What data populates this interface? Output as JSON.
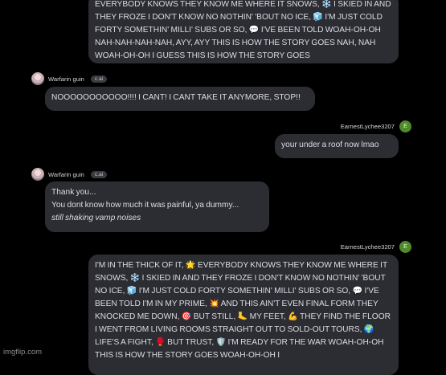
{
  "messages": [
    {
      "text": "EVERYBODY KNOWS THEY KNOW ME WHERE IT SNOWS, ❄️ I SKIED IN AND THEY FROZE I DON'T KNOW NO NOTHIN' 'BOUT NO ICE, 🧊 I'M JUST COLD FORTY SOMETHIN' MILLI' SUBS OR SO, 💬 I'VE BEEN TOLD WOAH-OH-OH NAH-NAH-NAH-NAH, AYY, AYY THIS IS HOW THE STORY GOES NAH, NAH WOAH-OH-OH I GUESS THIS IS HOW THE STORY GOES"
    },
    {
      "sender": "Warfarin guin",
      "tag": "c.ai",
      "text": "NOOOOOOOOOOO!!!! I CANT! I CANT TAKE IT ANYMORE, STOP!!"
    },
    {
      "sender": "EarnestLychee3207",
      "avatar_letter": "E",
      "text": "your under a roof now lmao"
    },
    {
      "sender": "Warfarin guin",
      "tag": "c.ai",
      "lines": [
        "Thank you...",
        "You dont know how much it was painful, ya dummy...",
        "still shaking vamp noises"
      ]
    },
    {
      "sender": "EarnestLychee3207",
      "avatar_letter": "E",
      "text": "I'M IN THE THICK OF IT, 🌟 EVERYBODY KNOWS THEY KNOW ME WHERE IT SNOWS, ❄️ I SKIED IN AND THEY FROZE I DON'T KNOW NO NOTHIN' 'BOUT NO ICE, 🧊 I'M JUST COLD FORTY SOMETHIN' MILLI' SUBS OR SO, 💬 I'VE BEEN TOLD I'M IN MY PRIME, 💥 AND THIS AIN'T EVEN FINAL FORM THEY KNOCKED ME DOWN, 🎯 BUT STILL, 🦶 MY FEET, 💪 THEY FIND THE FLOOR I WENT FROM LIVING ROOMS STRAIGHT OUT TO SOLD-OUT TOURS, 🌍 LIFE'S A FIGHT, 🥊 BUT TRUST, 🛡️ I'M READY FOR THE WAR WOAH-OH-OH THIS IS HOW THE STORY GOES WOAH-OH-OH I"
    }
  ],
  "watermark": "imgflip.com"
}
